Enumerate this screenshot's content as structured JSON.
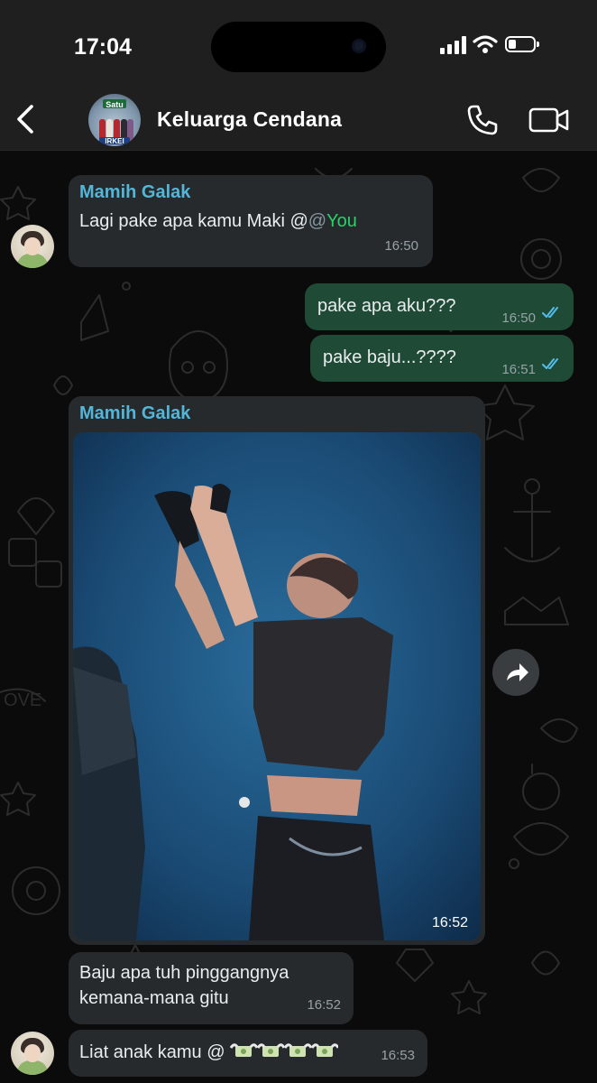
{
  "status_bar": {
    "time": "17:04"
  },
  "header": {
    "title": "Keluarga Cendana",
    "avatar_text_top": "Satu",
    "avatar_text_bottom": "IRKEI"
  },
  "messages": [
    {
      "sender": "Mamih Galak",
      "text": "Lagi pake apa kamu Maki @",
      "mention": "@",
      "mention_you": "You",
      "time": "16:50"
    },
    {
      "text": "pake apa aku???",
      "time": "16:50"
    },
    {
      "text": "pake baju...????",
      "time": "16:51"
    },
    {
      "sender": "Mamih Galak",
      "time": "16:52"
    },
    {
      "text_line1": "Baju apa tuh pinggangnya",
      "text_line2": "kemana-mana gitu",
      "time": "16:52"
    },
    {
      "text": "Liat anak kamu @",
      "time": "16:53"
    }
  ],
  "colors": {
    "incoming": "#262a2c",
    "outgoing": "#1f4a36",
    "sender": "#53b6d8",
    "mention_you": "#25d366",
    "ticks": "#53bdeb"
  }
}
